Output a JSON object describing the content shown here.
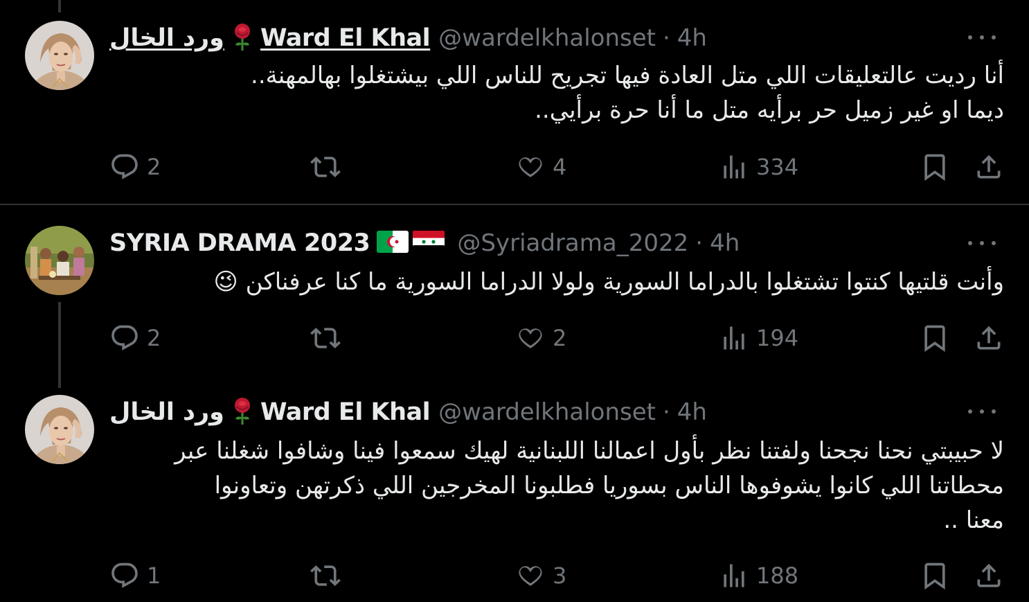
{
  "tweets": [
    {
      "display_name_ar": "ورد الخال",
      "display_name_en": "Ward El Khal",
      "name_emoji": "rose-emoji",
      "handle": "@wardelkhalonset",
      "dot": "·",
      "time": "4h",
      "lines": [
        "أنا رديت عالتعليقات اللي متل العادة فيها تجريح للناس اللي بيشتغلوا بهالمهنة..",
        "ديما او غير زميل حر برأيه متل ما أنا حرة برأيي.."
      ],
      "replies": "2",
      "reposts": "",
      "likes": "4",
      "views": "334"
    },
    {
      "display_name_en": "SYRIA DRAMA 2023",
      "flags": [
        "algeria-flag",
        "syria-flag"
      ],
      "handle": "@Syriadrama_2022",
      "dot": "·",
      "time": "4h",
      "lines": [
        "وأنت قلتيها كنتوا تشتغلوا بالدراما السورية ولولا الدراما السورية ما كنا عرفناكن 😉"
      ],
      "replies": "2",
      "reposts": "",
      "likes": "2",
      "views": "194"
    },
    {
      "display_name_ar": "ورد الخال",
      "display_name_en": "Ward El Khal",
      "name_emoji": "rose-emoji",
      "handle": "@wardelkhalonset",
      "dot": "·",
      "time": "4h",
      "lines": [
        "لا حبيبتي نحنا نجحنا ولفتنا نظر بأول اعمالنا اللبنانية لهيك سمعوا فينا وشافوا شغلنا عبر",
        "محطاتنا اللي كانوا يشوفوها الناس بسوريا  فطلبونا المخرجين اللي ذكرتهن وتعاونوا",
        "معنا .."
      ],
      "replies": "1",
      "reposts": "",
      "likes": "3",
      "views": "188"
    }
  ],
  "colors": {
    "background": "#000000",
    "text": "#e7e9ea",
    "muted": "#71767b",
    "divider": "#2f3336",
    "thread": "#333639"
  }
}
